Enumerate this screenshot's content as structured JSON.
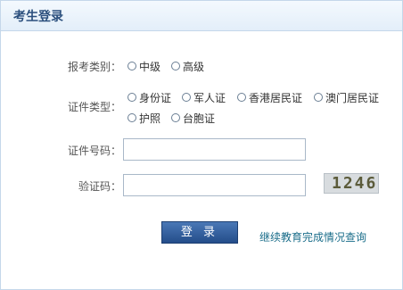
{
  "header": {
    "title": "考生登录"
  },
  "exam_category": {
    "label": "报考类别：",
    "options": [
      "中级",
      "高级"
    ]
  },
  "id_type": {
    "label": "证件类型：",
    "options": [
      "身份证",
      "军人证",
      "香港居民证",
      "澳门居民证",
      "护照",
      "台胞证"
    ]
  },
  "id_number": {
    "label": "证件号码：",
    "value": ""
  },
  "verify_code": {
    "label": "验证码：",
    "value": "",
    "captcha_text": "1246"
  },
  "login_button": {
    "label": "登 录"
  },
  "continue_link": {
    "label": "继续教育完成情况查询"
  }
}
